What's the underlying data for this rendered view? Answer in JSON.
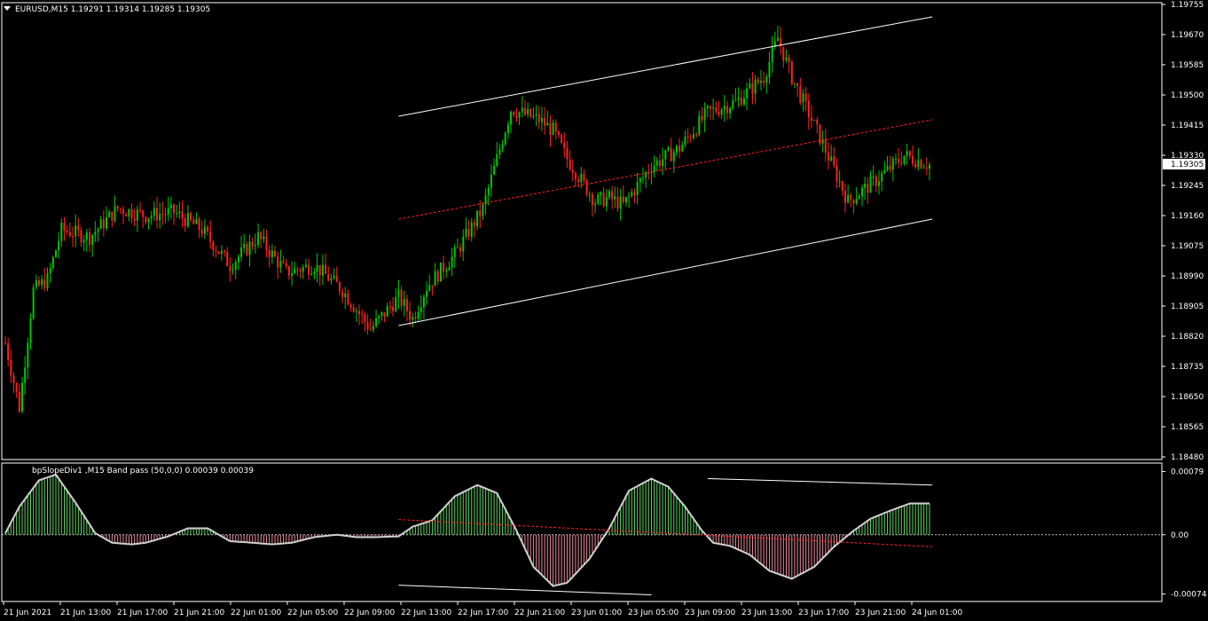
{
  "header": {
    "symbol_line": "EURUSD,M15  1.19291 1.19314 1.19285 1.19305",
    "menu_icon": "triangle-down-icon"
  },
  "colors": {
    "background": "#000000",
    "frame": "#ffffff",
    "bull_candle": "#00c800",
    "bear_candle": "#ff2020",
    "channel_line": "#ffffff",
    "channel_mid": "#ff2020",
    "osc_positive": "#5fd35f",
    "osc_negative": "#e88a9a",
    "osc_line": "#d0d0d0",
    "price_box_bg": "#ffffff",
    "price_box_text": "#000000"
  },
  "chart_data": [
    {
      "type": "candlestick",
      "name": "EURUSD,M15",
      "ylim": [
        1.1848,
        1.19755
      ],
      "price_ticks": [
        "1.19755",
        "1.19670",
        "1.19585",
        "1.19500",
        "1.19415",
        "1.19330",
        "1.19245",
        "1.19160",
        "1.19075",
        "1.18990",
        "1.18905",
        "1.18820",
        "1.18735",
        "1.18650",
        "1.18565",
        "1.18480"
      ],
      "current_price": "1.19305",
      "bar_count": 330,
      "series": [
        {
          "name": "close (approx. path)",
          "x_bar": [
            0,
            5,
            10,
            15,
            20,
            30,
            40,
            50,
            60,
            70,
            80,
            90,
            100,
            110,
            120,
            130,
            140,
            145,
            150,
            160,
            170,
            180,
            190,
            195,
            200,
            210,
            215,
            220,
            230,
            240,
            250,
            260,
            270,
            275,
            280,
            290,
            300,
            305,
            310,
            320,
            330
          ],
          "values": [
            1.188,
            1.1862,
            1.1895,
            1.1898,
            1.1912,
            1.191,
            1.1918,
            1.1916,
            1.1917,
            1.1912,
            1.1902,
            1.191,
            1.19,
            1.1902,
            1.1895,
            1.1884,
            1.1893,
            1.1887,
            1.1896,
            1.1905,
            1.1918,
            1.1946,
            1.1943,
            1.194,
            1.1932,
            1.192,
            1.1921,
            1.1919,
            1.193,
            1.1935,
            1.1945,
            1.1948,
            1.1955,
            1.1966,
            1.1955,
            1.1938,
            1.192,
            1.1923,
            1.1926,
            1.1933,
            1.193
          ]
        }
      ],
      "channel": {
        "upper": {
          "x_bar": [
            140,
            330
          ],
          "values": [
            1.1944,
            1.1972
          ]
        },
        "middle": {
          "x_bar": [
            140,
            330
          ],
          "values": [
            1.1915,
            1.1943
          ]
        },
        "lower": {
          "x_bar": [
            140,
            330
          ],
          "values": [
            1.1885,
            1.1915
          ]
        }
      }
    },
    {
      "type": "bar",
      "title": "bpSlopeDiv1 ,M15 Band pass (50,0,0) 0.00039 0.00039",
      "ylim": [
        -0.0008,
        0.00085
      ],
      "y_ticks": [
        "0.00079",
        "0.00",
        "-0.00074"
      ],
      "zero_label": "0.00",
      "x_bar": [
        0,
        5,
        12,
        18,
        25,
        32,
        38,
        45,
        50,
        58,
        65,
        72,
        80,
        88,
        95,
        102,
        110,
        118,
        125,
        132,
        140,
        145,
        152,
        160,
        168,
        175,
        182,
        188,
        195,
        200,
        208,
        215,
        222,
        230,
        236,
        242,
        248,
        252,
        258,
        265,
        272,
        280,
        288,
        295,
        302,
        308,
        315,
        322,
        330
      ],
      "values": [
        2e-05,
        0.00035,
        0.00068,
        0.00075,
        0.0004,
        2e-05,
        -0.0001,
        -0.00012,
        -0.0001,
        -2e-05,
        8e-05,
        8e-05,
        -8e-05,
        -0.0001,
        -0.00012,
        -0.0001,
        -3e-05,
        0.0,
        -3e-05,
        -3e-05,
        -2e-05,
        0.0001,
        0.00018,
        0.00048,
        0.00062,
        0.00052,
        5e-05,
        -0.0004,
        -0.00064,
        -0.0006,
        -0.0003,
        8e-05,
        0.00055,
        0.0007,
        0.0006,
        0.00035,
        5e-05,
        -0.0001,
        -0.00014,
        -0.00025,
        -0.00045,
        -0.00055,
        -0.0004,
        -0.00015,
        5e-05,
        0.0002,
        0.0003,
        0.00039,
        0.00039
      ],
      "trend_lines": {
        "upper": {
          "x_bar": [
            250,
            330
          ],
          "values": [
            0.0007,
            0.00062
          ]
        },
        "middle": {
          "x_bar": [
            140,
            330
          ],
          "values": [
            0.00019,
            -0.00015
          ]
        },
        "lower": {
          "x_bar": [
            140,
            230
          ],
          "values": [
            -0.00063,
            -0.00075
          ]
        }
      }
    }
  ],
  "time_axis": [
    "21 Jun 2021",
    "21 Jun 13:00",
    "21 Jun 17:00",
    "21 Jun 21:00",
    "22 Jun 01:00",
    "22 Jun 05:00",
    "22 Jun 09:00",
    "22 Jun 13:00",
    "22 Jun 17:00",
    "22 Jun 21:00",
    "23 Jun 01:00",
    "23 Jun 05:00",
    "23 Jun 09:00",
    "23 Jun 13:00",
    "23 Jun 17:00",
    "23 Jun 21:00",
    "24 Jun 01:00"
  ]
}
